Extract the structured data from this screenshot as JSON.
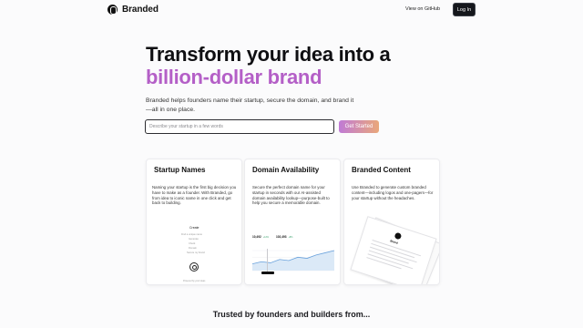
{
  "brand": {
    "name": "Branded"
  },
  "nav": {
    "github_label": "View on GitHub",
    "login_label": "Log In"
  },
  "hero": {
    "title_line1": "Transform your idea into a",
    "title_line2": "billion-dollar brand",
    "subtitle": "Branded helps founders name their startup, secure the domain, and brand it—all in one place.",
    "accent_color": "#b45fc7"
  },
  "search": {
    "placeholder": "Describe your startup in a few words",
    "value": "",
    "cta_label": "Get Started"
  },
  "cards": [
    {
      "title": "Startup Names",
      "text": "Naming your startup is the first big decision you have to make as a founder. With Branded, go from idea to iconic name in one click and get back to building.",
      "illustration": {
        "title": "Create",
        "items": [
          "Find a unique name",
          "Generate",
          "Check",
          "Domain",
          "Secure my brand"
        ],
        "footer": "Powered by your ideas"
      }
    },
    {
      "title": "Domain Availability",
      "text": "Secure the perfect domain name for your startup in seconds with our AI-assisted domain availability lookup—purpose-built to help you secure a memorable domain.",
      "stats": [
        {
          "value": "10,492",
          "change": "+12%"
        },
        {
          "value": "102,493",
          "change": "+8%"
        }
      ],
      "series": [
        3,
        4,
        3.5,
        5,
        4.5,
        6,
        5.5,
        7,
        8,
        9
      ]
    },
    {
      "title": "Branded Content",
      "text": "Use Branded to generate custom branded content—including logos and one-pagers—for your startup without the headaches.",
      "doc_title": "Brand"
    }
  ],
  "trusted": {
    "label": "Trusted by founders and builders from..."
  }
}
